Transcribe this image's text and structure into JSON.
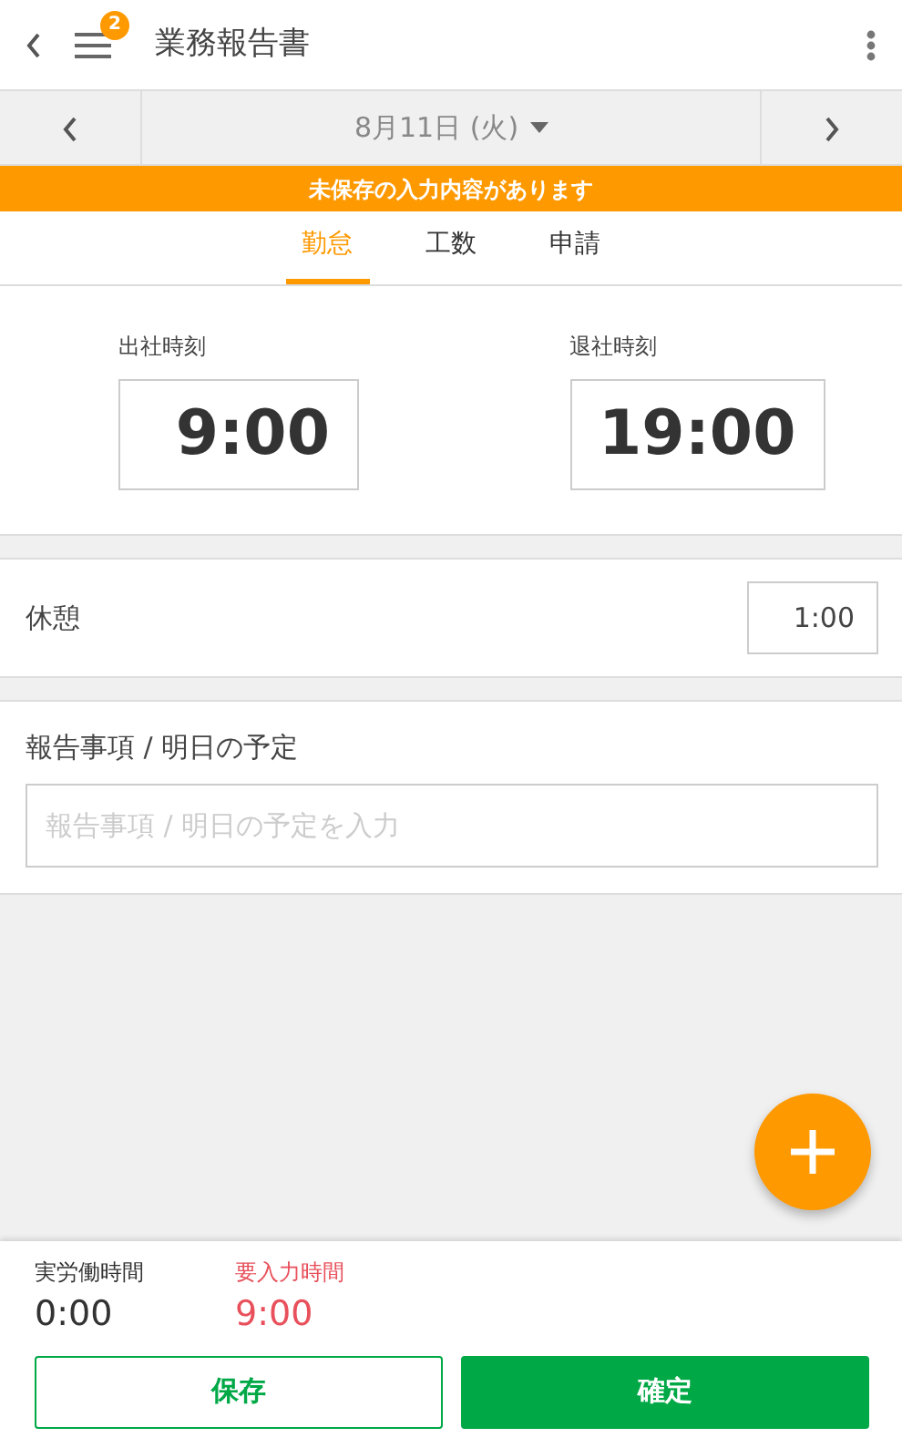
{
  "header": {
    "title": "業務報告書",
    "badge": "2"
  },
  "date_bar": {
    "label": "8月11日 (火)"
  },
  "banner": {
    "text": "未保存の入力内容があります"
  },
  "tabs": [
    {
      "label": "勤怠",
      "selected": true
    },
    {
      "label": "工数",
      "selected": false
    },
    {
      "label": "申請",
      "selected": false
    }
  ],
  "times": [
    {
      "label": "出社時刻",
      "value": "9:00"
    },
    {
      "label": "退社時刻",
      "value": "19:00"
    }
  ],
  "break": {
    "label": "休憩",
    "value": "1:00"
  },
  "report": {
    "label": "報告事項 / 明日の予定",
    "placeholder": "報告事項 / 明日の予定を入力"
  },
  "summary": [
    {
      "label": "実労働時間",
      "value": "0:00",
      "kind": "normal"
    },
    {
      "label": "要入力時間",
      "value": "9:00",
      "kind": "warning"
    }
  ],
  "buttons": [
    {
      "label": "保存",
      "kind": "outline"
    },
    {
      "label": "確定",
      "kind": "filled"
    }
  ]
}
